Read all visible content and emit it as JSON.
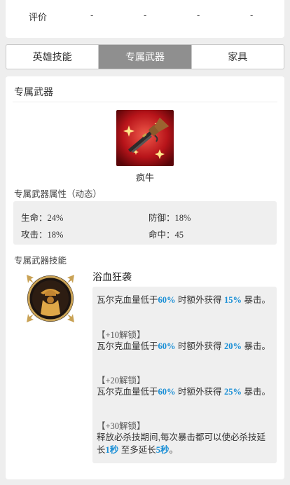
{
  "rating": {
    "label": "评价",
    "values": [
      "-",
      "-",
      "-",
      "-"
    ]
  },
  "tabs": [
    {
      "label": "英雄技能",
      "active": false
    },
    {
      "label": "专属武器",
      "active": true
    },
    {
      "label": "家具",
      "active": false
    }
  ],
  "weapon": {
    "section_title": "专属武器",
    "name": "疯牛",
    "image_icon": "rifle-icon",
    "attr_title": "专属武器属性（动态）",
    "attrs": {
      "hp": "生命：24%",
      "def": "防御：18%",
      "atk": "攻击：18%",
      "hit": "命中：45"
    }
  },
  "skill": {
    "section_title": "专属武器技能",
    "icon": "cowboy-skill-icon",
    "name": "浴血狂袭",
    "base": {
      "prefix": "瓦尔克血量低于",
      "threshold": "60%",
      "mid": "时额外获得",
      "value": "15%",
      "suffix": "暴击。"
    },
    "unlock10": {
      "label": "【+10解锁】",
      "prefix": "瓦尔克血量低于",
      "threshold": "60%",
      "mid": "时额外获得",
      "value": "20%",
      "suffix": "暴击。"
    },
    "unlock20": {
      "label": "【+20解锁】",
      "prefix": "瓦尔克血量低于",
      "threshold": "60%",
      "mid": "时额外获得",
      "value": "25%",
      "suffix": "暴击。"
    },
    "unlock30": {
      "label": "【+30解锁】",
      "text1": "释放必杀技期间,每次暴击都可以使必杀技延长",
      "v1": "1秒",
      "mid": "至多延长",
      "v2": "5秒",
      "end": "。"
    }
  },
  "colors": {
    "accent": "#1a8fd6",
    "tab_active": "#8f8f8f"
  }
}
